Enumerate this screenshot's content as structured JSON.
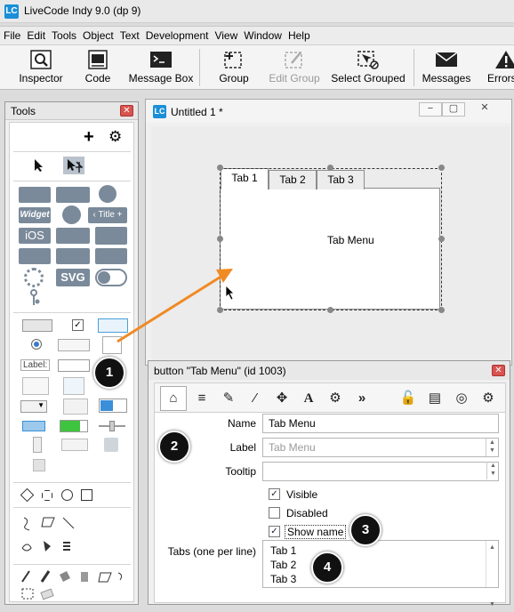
{
  "app": {
    "title": "LiveCode Indy 9.0 (dp 9)",
    "logo": "LC"
  },
  "menubar": {
    "items": [
      "File",
      "Edit",
      "Tools",
      "Object",
      "Text",
      "Development",
      "View",
      "Window",
      "Help"
    ]
  },
  "toolbar": {
    "buttons": [
      {
        "label": "Inspector",
        "icon": "inspector-icon",
        "enabled": true
      },
      {
        "label": "Code",
        "icon": "code-icon",
        "enabled": true
      },
      {
        "label": "Message Box",
        "icon": "message-box-icon",
        "enabled": true
      },
      {
        "label": "Group",
        "icon": "group-icon",
        "enabled": true
      },
      {
        "label": "Edit Group",
        "icon": "edit-group-icon",
        "enabled": false
      },
      {
        "label": "Select Grouped",
        "icon": "select-grouped-icon",
        "enabled": true
      },
      {
        "label": "Messages",
        "icon": "messages-icon",
        "enabled": true
      },
      {
        "label": "Errors",
        "icon": "errors-icon",
        "enabled": true
      }
    ]
  },
  "tools": {
    "title": "Tools",
    "close": "✕",
    "add": "+",
    "widget_label": "Widget",
    "title_label": "‹ Title +",
    "ios_label": "iOS",
    "svg_label": "SVG",
    "field_label": "Label:"
  },
  "stack": {
    "title": "Untitled 1 *",
    "tabs": [
      "Tab 1",
      "Tab 2",
      "Tab 3"
    ],
    "content": "Tab Menu",
    "controls": [
      "−",
      "▢",
      "✕"
    ]
  },
  "inspector": {
    "title": "button \"Tab Menu\" (id 1003)",
    "close": "✕",
    "props": {
      "name_label": "Name",
      "name_value": "Tab Menu",
      "label_label": "Label",
      "label_placeholder": "Tab Menu",
      "tooltip_label": "Tooltip",
      "tooltip_value": "",
      "visible_label": "Visible",
      "visible_checked": true,
      "disabled_label": "Disabled",
      "disabled_checked": false,
      "showname_label": "Show name",
      "showname_checked": true,
      "tabs_label": "Tabs (one per line)",
      "tabs_lines": [
        "Tab 1",
        "Tab 2",
        "Tab 3"
      ]
    }
  },
  "callouts": [
    "1",
    "2",
    "3",
    "4"
  ],
  "colors": {
    "accent": "#1a8fd8",
    "arrow": "#f08a24",
    "badge": "#111111",
    "close": "#d9534f"
  }
}
